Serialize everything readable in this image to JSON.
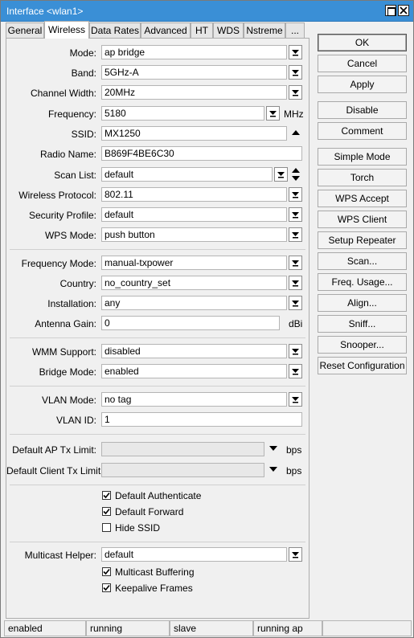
{
  "window": {
    "title": "Interface <wlan1>"
  },
  "tabs": [
    "General",
    "Wireless",
    "Data Rates",
    "Advanced",
    "HT",
    "WDS",
    "Nstreme",
    "..."
  ],
  "form": {
    "mode": {
      "label": "Mode:",
      "value": "ap bridge"
    },
    "band": {
      "label": "Band:",
      "value": "5GHz-A"
    },
    "channel_width": {
      "label": "Channel Width:",
      "value": "20MHz"
    },
    "frequency": {
      "label": "Frequency:",
      "value": "5180",
      "unit": "MHz"
    },
    "ssid": {
      "label": "SSID:",
      "value": "MX1250"
    },
    "radio_name": {
      "label": "Radio Name:",
      "value": "B869F4BE6C30"
    },
    "scan_list": {
      "label": "Scan List:",
      "value": "default"
    },
    "wireless_protocol": {
      "label": "Wireless Protocol:",
      "value": "802.11"
    },
    "security_profile": {
      "label": "Security Profile:",
      "value": "default"
    },
    "wps_mode": {
      "label": "WPS Mode:",
      "value": "push button"
    },
    "frequency_mode": {
      "label": "Frequency Mode:",
      "value": "manual-txpower"
    },
    "country": {
      "label": "Country:",
      "value": "no_country_set"
    },
    "installation": {
      "label": "Installation:",
      "value": "any"
    },
    "antenna_gain": {
      "label": "Antenna Gain:",
      "value": "0",
      "unit": "dBi"
    },
    "wmm_support": {
      "label": "WMM Support:",
      "value": "disabled"
    },
    "bridge_mode": {
      "label": "Bridge Mode:",
      "value": "enabled"
    },
    "vlan_mode": {
      "label": "VLAN Mode:",
      "value": "no tag"
    },
    "vlan_id": {
      "label": "VLAN ID:",
      "value": "1"
    },
    "default_ap_tx_limit": {
      "label": "Default AP Tx Limit:",
      "value": "",
      "unit": "bps"
    },
    "default_client_tx_limit": {
      "label": "Default Client Tx Limit:",
      "value": "",
      "unit": "bps"
    },
    "default_authenticate": {
      "label": "Default Authenticate",
      "checked": true
    },
    "default_forward": {
      "label": "Default Forward",
      "checked": true
    },
    "hide_ssid": {
      "label": "Hide SSID",
      "checked": false
    },
    "multicast_helper": {
      "label": "Multicast Helper:",
      "value": "default"
    },
    "multicast_buffering": {
      "label": "Multicast Buffering",
      "checked": true
    },
    "keepalive_frames": {
      "label": "Keepalive Frames",
      "checked": true
    }
  },
  "buttons": {
    "ok": "OK",
    "cancel": "Cancel",
    "apply": "Apply",
    "disable": "Disable",
    "comment": "Comment",
    "simple_mode": "Simple Mode",
    "torch": "Torch",
    "wps_accept": "WPS Accept",
    "wps_client": "WPS Client",
    "setup_repeater": "Setup Repeater",
    "scan": "Scan...",
    "freq_usage": "Freq. Usage...",
    "align": "Align...",
    "sniff": "Sniff...",
    "snooper": "Snooper...",
    "reset_configuration": "Reset Configuration"
  },
  "status": [
    "enabled",
    "running",
    "slave",
    "running ap",
    ""
  ],
  "colors": {
    "titlebar": "#3a8fd6"
  }
}
